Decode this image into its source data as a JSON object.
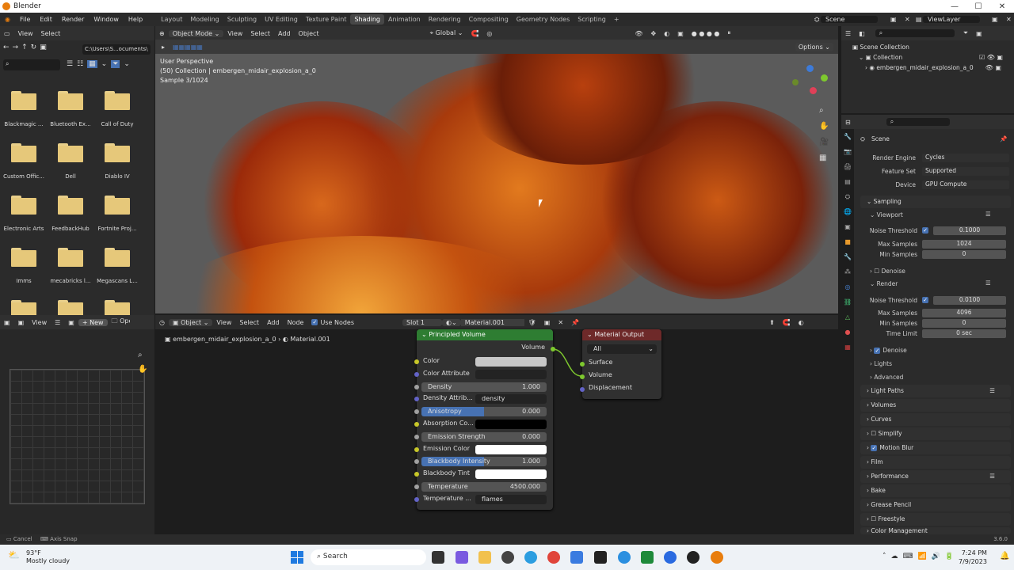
{
  "window": {
    "title": "Blender"
  },
  "menu": [
    "File",
    "Edit",
    "Render",
    "Window",
    "Help"
  ],
  "workspaces": [
    "Layout",
    "Modeling",
    "Sculpting",
    "UV Editing",
    "Texture Paint",
    "Shading",
    "Animation",
    "Rendering",
    "Compositing",
    "Geometry Nodes",
    "Scripting",
    "+"
  ],
  "active_workspace": "Shading",
  "scene": "Scene",
  "viewlayer": "ViewLayer",
  "filebrowser": {
    "view": "View",
    "select": "Select",
    "path": "C:\\Users\\S...ocuments\\",
    "folders": [
      "Blackmagic ...",
      "Bluetooth Ex...",
      "Call of Duty",
      "Custom Offic...",
      "Dell",
      "Diablo IV",
      "Electronic Arts",
      "FeedbackHub",
      "Fortnite Proj...",
      "Imms",
      "mecabricks l...",
      "Megascans L..."
    ]
  },
  "viewport": {
    "mode": "Object Mode",
    "view": "View",
    "select": "Select",
    "add": "Add",
    "object": "Object",
    "orientation": "Global",
    "options": "Options",
    "info1": "User Perspective",
    "info2": "(50) Collection | embergen_midair_explosion_a_0",
    "info3": "Sample 3/1024"
  },
  "outliner": {
    "scene_collection": "Scene Collection",
    "collection": "Collection",
    "object": "embergen_midair_explosion_a_0"
  },
  "properties": {
    "scene": "Scene",
    "render_engine_label": "Render Engine",
    "render_engine": "Cycles",
    "feature_set_label": "Feature Set",
    "feature_set": "Supported",
    "device_label": "Device",
    "device": "GPU Compute",
    "sampling": "Sampling",
    "viewport": "Viewport",
    "noise_threshold_label": "Noise Threshold",
    "vp_noise": "0.1000",
    "max_samples_label": "Max Samples",
    "vp_max": "1024",
    "min_samples_label": "Min Samples",
    "vp_min": "0",
    "denoise": "Denoise",
    "render": "Render",
    "r_noise": "0.0100",
    "r_max": "4096",
    "r_min": "0",
    "time_limit_label": "Time Limit",
    "r_time": "0 sec",
    "lights": "Lights",
    "advanced": "Advanced",
    "sections": [
      "Light Paths",
      "Volumes",
      "Curves",
      "Simplify",
      "Motion Blur",
      "Film",
      "Performance",
      "Bake",
      "Grease Pencil",
      "Freestyle",
      "Color Management"
    ]
  },
  "image_editor": {
    "view": "View",
    "new": "New",
    "open": "Open"
  },
  "node_editor": {
    "object": "Object",
    "view": "View",
    "select": "Select",
    "add": "Add",
    "node": "Node",
    "use_nodes": "Use Nodes",
    "slot": "Slot 1",
    "material": "Material.001",
    "breadcrumb_obj": "embergen_midair_explosion_a_0",
    "breadcrumb_mat": "Material.001"
  },
  "pv": {
    "title": "Principled Volume",
    "output": "Volume",
    "rows": [
      {
        "label": "Color",
        "value": "",
        "kind": "color",
        "sock": "#c7c729"
      },
      {
        "label": "Color Attribute",
        "value": "",
        "kind": "text",
        "sock": "#6363c7"
      },
      {
        "label": "Density",
        "value": "1.000",
        "kind": "num",
        "sock": "#a1a1a1"
      },
      {
        "label": "Density Attrib...",
        "value": "density",
        "kind": "text",
        "sock": "#6363c7"
      },
      {
        "label": "Anisotropy",
        "value": "0.000",
        "kind": "slider",
        "sock": "#a1a1a1"
      },
      {
        "label": "Absorption Co...",
        "value": "",
        "kind": "black",
        "sock": "#c7c729"
      },
      {
        "label": "Emission Strength",
        "value": "0.000",
        "kind": "num",
        "sock": "#a1a1a1"
      },
      {
        "label": "Emission Color",
        "value": "",
        "kind": "white",
        "sock": "#c7c729"
      },
      {
        "label": "Blackbody Intensity",
        "value": "1.000",
        "kind": "slider",
        "sock": "#a1a1a1"
      },
      {
        "label": "Blackbody Tint",
        "value": "",
        "kind": "white",
        "sock": "#c7c729"
      },
      {
        "label": "Temperature",
        "value": "4500.000",
        "kind": "num",
        "sock": "#a1a1a1"
      },
      {
        "label": "Temperature ...",
        "value": "flames",
        "kind": "text",
        "sock": "#6363c7"
      }
    ]
  },
  "mo": {
    "title": "Material Output",
    "target": "All",
    "inputs": [
      "Surface",
      "Volume",
      "Displacement"
    ]
  },
  "status": {
    "cancel": "Cancel",
    "axis_snap": "Axis Snap",
    "version": "3.6.0"
  },
  "taskbar": {
    "temp": "93°F",
    "weather": "Mostly cloudy",
    "search": "Search",
    "time": "7:24 PM",
    "date": "7/9/2023"
  },
  "colors": {
    "accent": "#4772b3",
    "node_header": "#2e7d32",
    "workspace_active": "#474747"
  }
}
